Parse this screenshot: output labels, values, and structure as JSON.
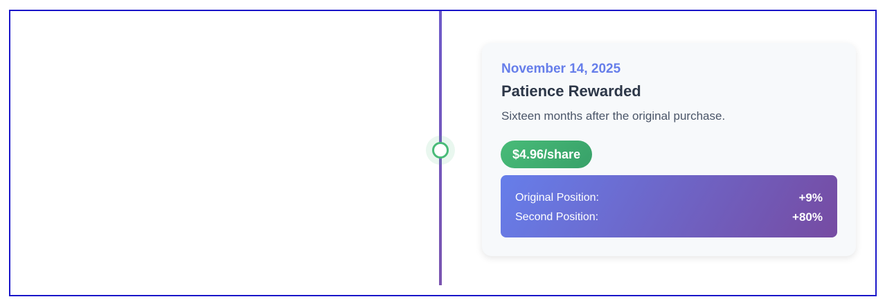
{
  "event": {
    "date": "November 14, 2025",
    "title": "Patience Rewarded",
    "description": "Sixteen months after the original purchase.",
    "price_badge": "$4.96/share",
    "positions": [
      {
        "label": "Original Position:",
        "value": "+9%"
      },
      {
        "label": "Second Position:",
        "value": "+80%"
      }
    ]
  },
  "colors": {
    "frame_border": "#1a16c9",
    "timeline_line": "#6e5ac9",
    "marker": "#48bb78",
    "date_text": "#667eea",
    "badge": "#48bb78",
    "positions_gradient_start": "#667eea",
    "positions_gradient_end": "#764ba2"
  }
}
